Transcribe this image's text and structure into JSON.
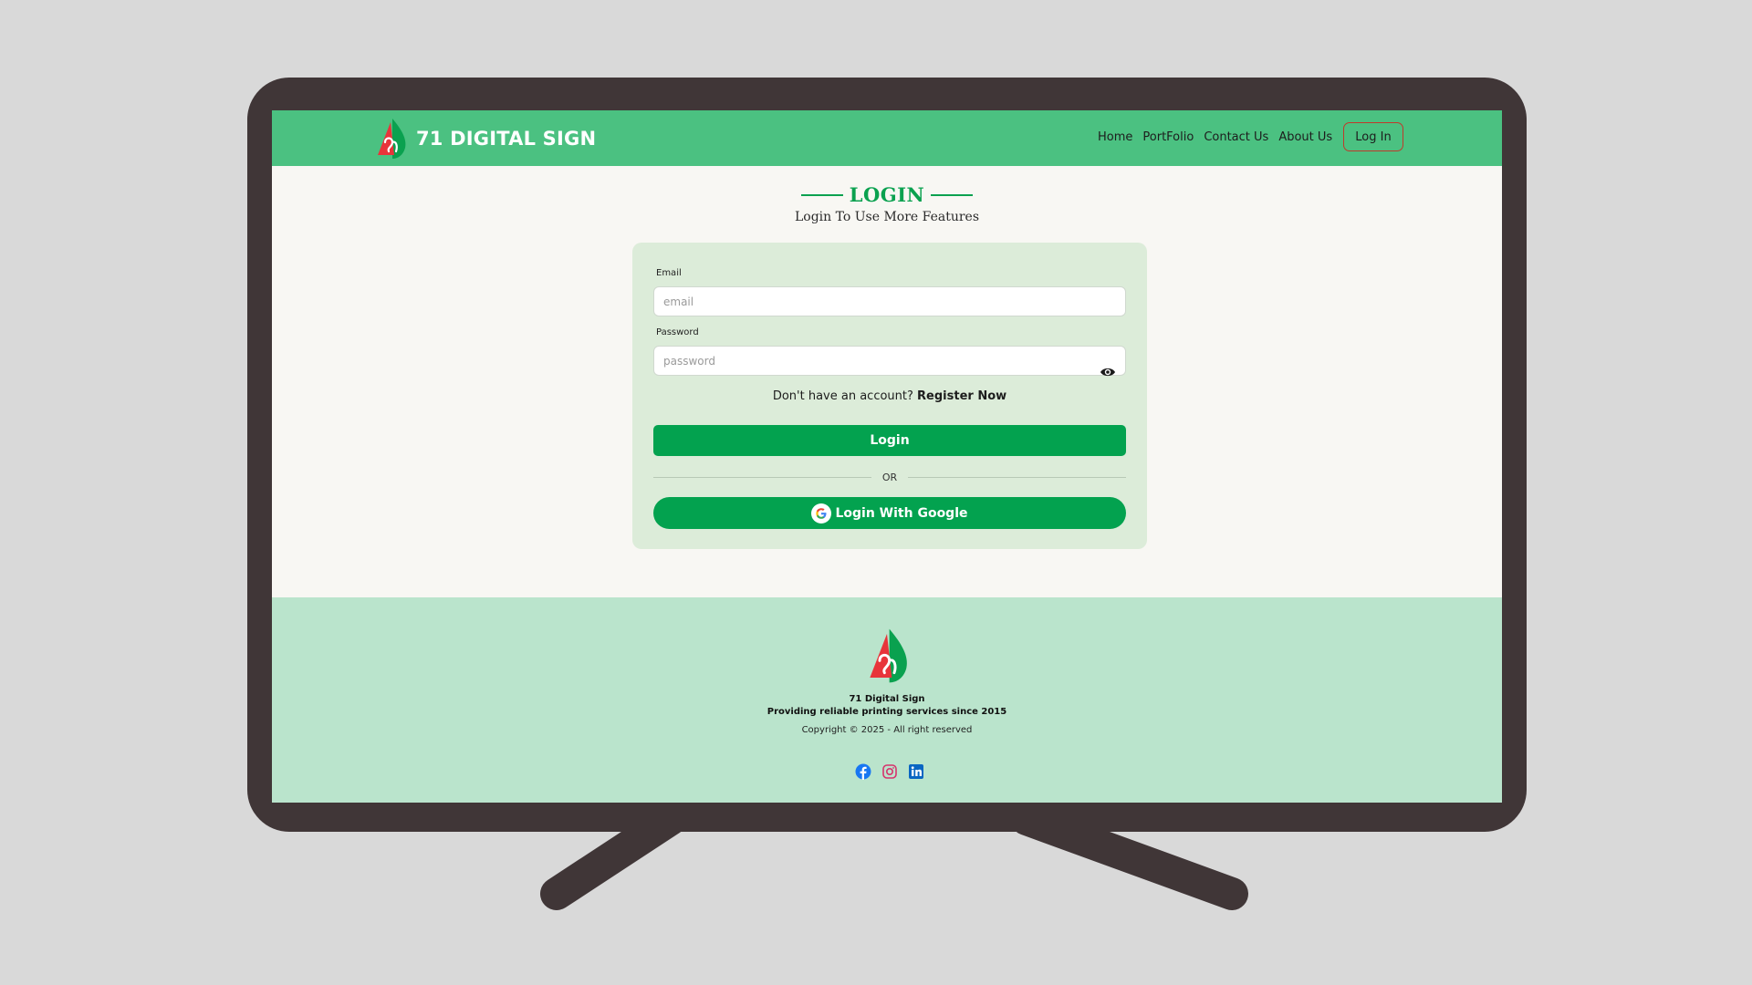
{
  "brand": {
    "name": "71 DIGITAL SIGN"
  },
  "nav": {
    "links": [
      "Home",
      "PortFolio",
      "Contact Us",
      "About Us"
    ],
    "login_label": "Log In"
  },
  "header": {
    "title": "LOGIN",
    "subtitle": "Login To Use More Features"
  },
  "form": {
    "email_label": "Email",
    "email_placeholder": "email",
    "email_value": "",
    "password_label": "Password",
    "password_placeholder": "password",
    "password_value": "",
    "register_prompt": "Don't have an account?",
    "register_link": "Register Now",
    "login_button": "Login",
    "or_text": "OR",
    "google_button": "Login With Google"
  },
  "footer": {
    "name": "71 Digital Sign",
    "tagline": "Providing reliable printing services since 2015",
    "copyright": "Copyright © 2025 - All right reserved",
    "socials": [
      "facebook-icon",
      "instagram-icon",
      "linkedin-icon"
    ]
  },
  "colors": {
    "navbar": "#4bc181",
    "primary_green": "#03a24f",
    "card_bg": "#dcecd9",
    "footer_bg": "#bae4cc",
    "monitor_frame": "#403637",
    "logo_red": "#e8343a",
    "logo_green": "#0aa14f"
  }
}
